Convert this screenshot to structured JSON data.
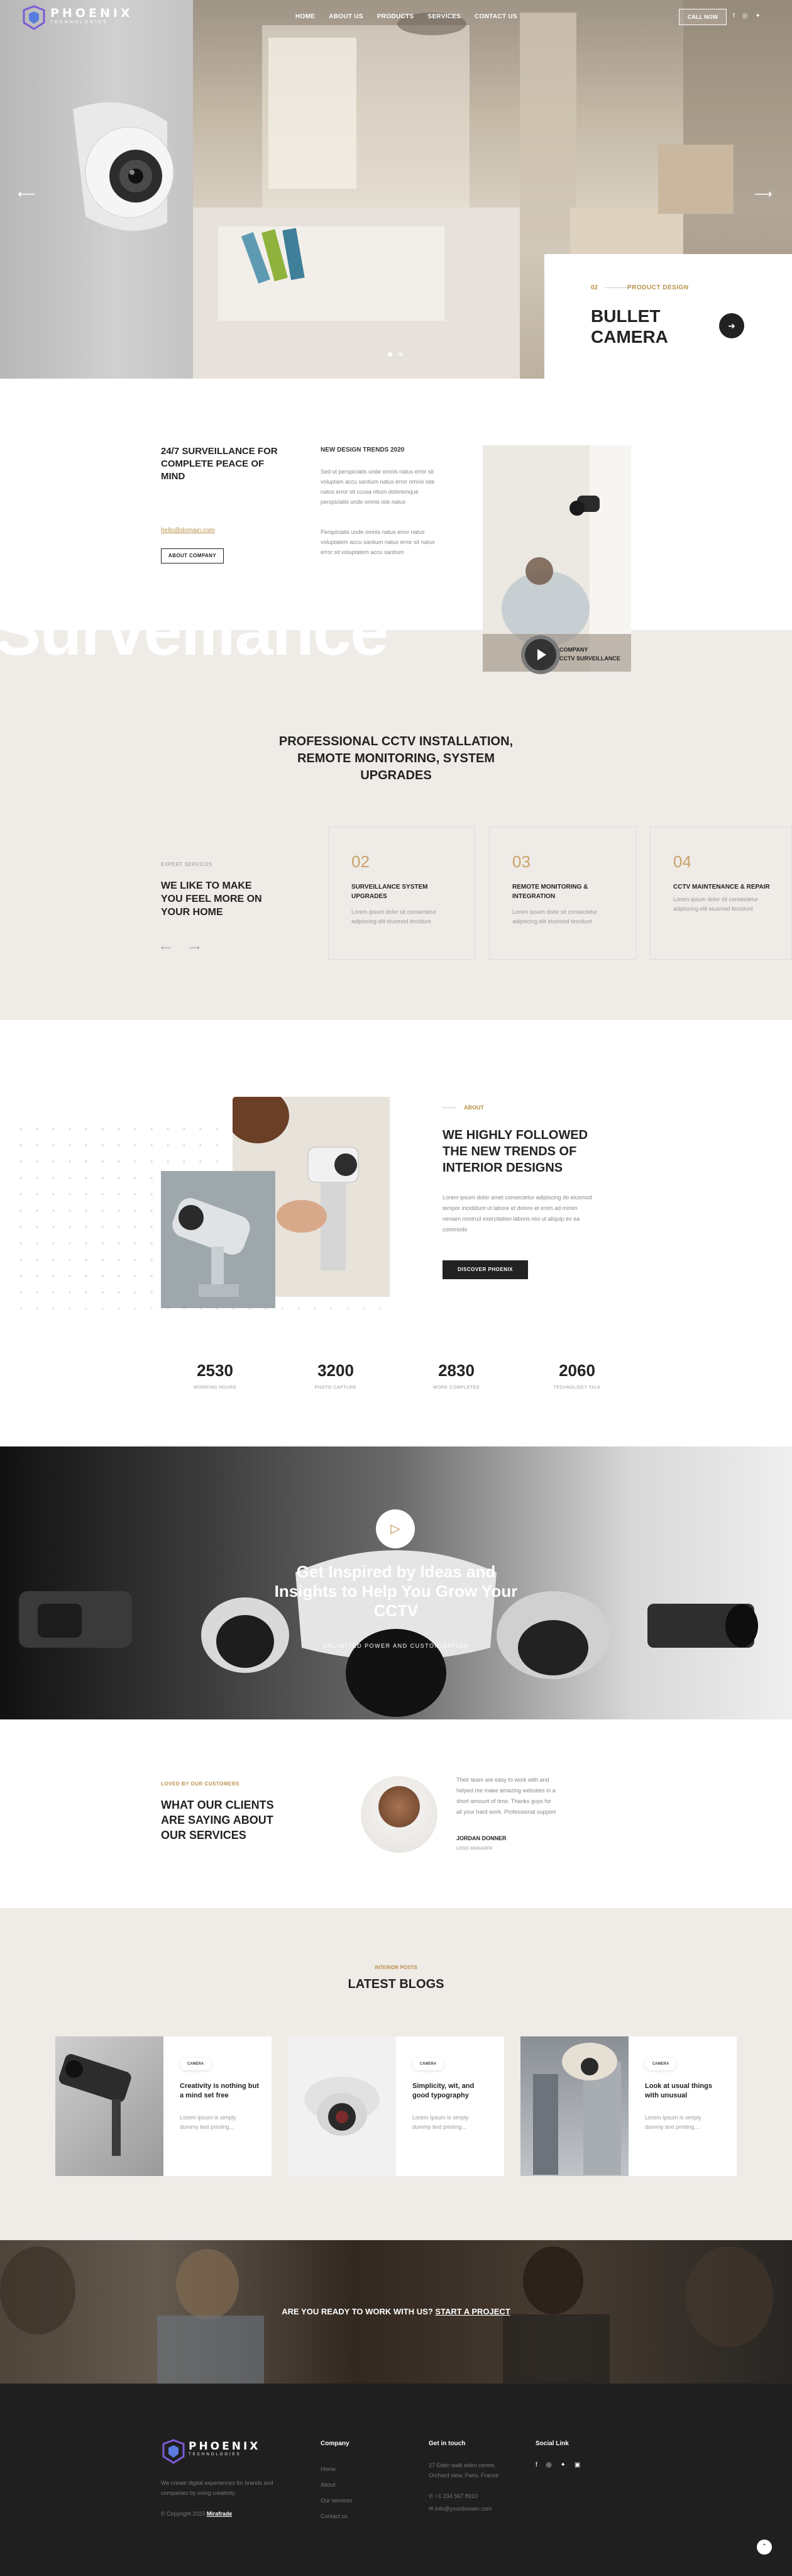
{
  "brand": {
    "name": "PHOENIX",
    "sub": "TECHNOLOGIES",
    "accent": "#b8904a",
    "dark": "#222222"
  },
  "nav": {
    "items": [
      "HOME",
      "ABOUT US",
      "PRODUCTS",
      "SERVICES",
      "CONTACT US"
    ],
    "call_label": "CALL NOW",
    "social": [
      "f",
      "◎",
      "✦"
    ]
  },
  "hero": {
    "num": "02",
    "category": "PRODUCT DESIGN",
    "title": "BULLET CAMERA",
    "prev_icon": "⟵",
    "next_icon": "⟶"
  },
  "about": {
    "title": "24/7 SURVEILLANCE FOR COMPLETE PEACE OF MIND",
    "email": "hello@domain.com",
    "button": "ABOUT COMPANY",
    "trend_heading": "NEW DESIGN TRENDS 2020",
    "trend_p1": "Sed ut perspiciatis unde omnis natus error sit voluptam accu santium natus error omnis iste natus error sit ccusa ntium doloremque perspiciatis unde omnis iste natus",
    "trend_p2": "Perspiciatis unde omnis natus error natus voluptatem accu santium natus error sit natus error sit voluptatem accu santium",
    "big_word": "Surveillance",
    "play_line1": "COMPANY",
    "play_line2": "CCTV SURVEILLANCE"
  },
  "services": {
    "heading": "PROFESSIONAL CCTV INSTALLATION, REMOTE MONITORING, SYSTEM UPGRADES",
    "label": "EXPERT SERVICES",
    "title": "WE LIKE TO MAKE YOU FEEL MORE ON YOUR HOME",
    "arrows": "⟵ ⟶",
    "cards": [
      {
        "num": "02",
        "title": "SURVEILLANCE SYSTEM UPGRADES",
        "desc": "Lorem ipsum dolor sit consectetur adipiscing elit eiusmod tincidunt"
      },
      {
        "num": "03",
        "title": "REMOTE MONITORING & INTEGRATION",
        "desc": "Lorem ipsum dolor sit consectetur adipiscing elit eiusmod tincidunt"
      },
      {
        "num": "04",
        "title": "CCTV MAINTENANCE & REPAIR",
        "desc": "Lorem ipsum dolor sit consectetur adipiscing elit eiusmod tincidunt"
      }
    ]
  },
  "features": {
    "label": "ABOUT",
    "title": "WE HIGHLY FOLLOWED THE NEW TRENDS OF INTERIOR DESIGNS",
    "text": "Lorem ipsum dolor amet consectetur adipiscing do eiusmod tempor incididunt ut labore et dolore et enim ad minim veniam nostrud exercitation laboris nisi ut aliquip ex ea commodo",
    "button": "DISCOVER PHOENIX",
    "stats": [
      {
        "value": "2530",
        "label": "WORKING HOURS"
      },
      {
        "value": "3200",
        "label": "PHOTO CAPTURE"
      },
      {
        "value": "2830",
        "label": "WORK COMPLETED"
      },
      {
        "value": "2060",
        "label": "TECHNOLOGY TALK"
      }
    ]
  },
  "video": {
    "play_icon": "▷",
    "title": "Get Inspired by Ideas and Insights to Help You Grow Your CCTV",
    "sub": "UNLIMITED POWER AND CUSTOMIZATION"
  },
  "testimonial": {
    "label": "LOVED BY OUR CUSTOMERS",
    "title": "WHAT OUR CLIENTS ARE SAYING ABOUT OUR SERVICES",
    "quote": "Their team are easy to work with and helped me make amazing websites in a short amount of time. Thanks guys for all your hard work. Professional support",
    "name": "JORDAN DONNER",
    "role": "LOGO MANAGER"
  },
  "blog": {
    "label": "INTERIOR POSTS",
    "title": "LATEST BLOGS",
    "posts": [
      {
        "tag": "CAMERA",
        "title": "Creativity is nothing but a mind set free",
        "desc": "Lorem Ipsum is simply dummy text printing..."
      },
      {
        "tag": "CAMERA",
        "title": "Simplicity, wit, and good typography",
        "desc": "Lorem Ipsum is simply dummy text printing..."
      },
      {
        "tag": "CAMERA",
        "title": "Look at usual things with unusual",
        "desc": "Lorem Ipsum is simply dummy text printing..."
      }
    ]
  },
  "cta": {
    "text": "ARE YOU READY TO WORK WITH US? ",
    "link": "START A PROJECT"
  },
  "footer": {
    "desc": "We create digital experiences for brands and companies by using creativity.",
    "copy_prefix": "© Copyright 2023 ",
    "copy_brand": "Mirafrade",
    "company_heading": "Company",
    "company_links": [
      "Home",
      "About",
      "Our services",
      "Contact us"
    ],
    "contact_heading": "Get in touch",
    "contact_address": "27 Eden walk eden centre, Orchard view, Paris, France",
    "contact_phone": "+1 234 567 8910",
    "contact_email": "info@yourdomain.com",
    "social_heading": "Social Link",
    "social": [
      "f",
      "◎",
      "✦",
      "▣"
    ],
    "scroll_icon": "⌃"
  }
}
